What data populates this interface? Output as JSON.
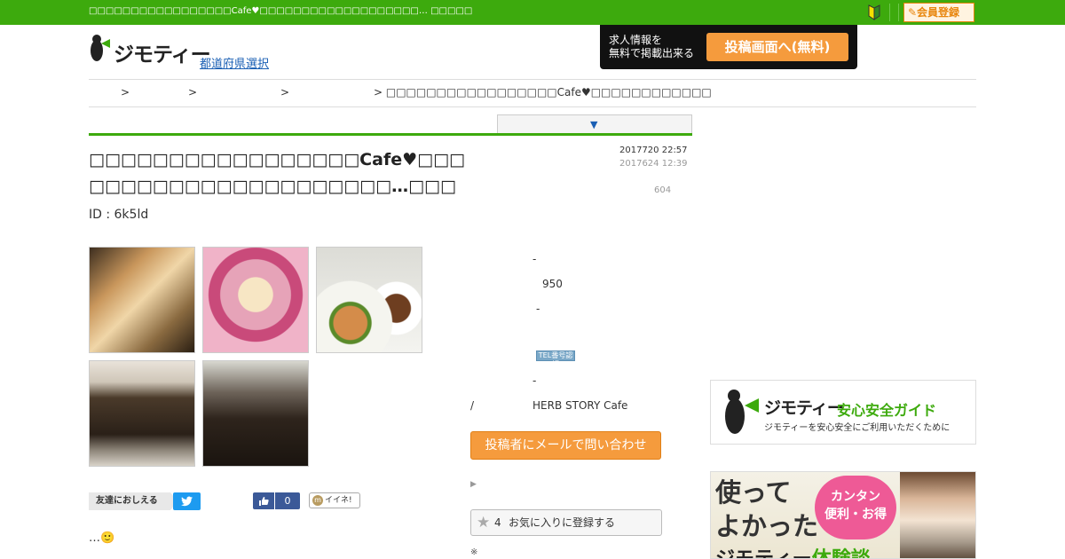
{
  "topbar": {
    "message": "□□□□□□□□□□□□□□□□□Cafe♥□□□□□□□□□□□□□□□□□□□… □□□□□",
    "register_label": "✎会員登録",
    "icons": [
      "beginner-mark-icon",
      "pencil-icon"
    ]
  },
  "header": {
    "logo_text": "ジモティー",
    "prefecture_link": "都道府県選択",
    "banner_text_line1": "求人情報を",
    "banner_text_line2": "無料で掲載出来る",
    "banner_button": "投稿画面へ(無料)"
  },
  "breadcrumb": {
    "sep1": ">",
    "sep2": ">",
    "sep3": ">",
    "current": ">  □□□□□□□□□□□□□□□□□Cafe♥□□□□□□□□□□□□"
  },
  "post": {
    "toggle_arrow": "▼",
    "title_line1": "□□□□□□□□□□□□□□□□□Cafe♥□□□",
    "title_line2": "□□□□□□□□□□□□□□□□□□□…□□□",
    "posted_date": "2017720 22:57",
    "updated_date": "2017624 12:39",
    "views": "604",
    "id_text": "ID : 6k5ld"
  },
  "details": {
    "row1": "-",
    "row2": "950",
    "row3": "-",
    "tel_badge": "TEL番号認証",
    "row5": "-",
    "row6_label": "/",
    "row6_value": "HERB STORY Cafe",
    "mail_button": "投稿者にメールで問い合わせ",
    "more_triangle": "▶",
    "fav_count": "4",
    "fav_label": "お気に入りに登録する",
    "note_mark": "※"
  },
  "share": {
    "label": "友達におしえる",
    "twitter_glyph": "🐦",
    "fb_glyph": "👍",
    "fb_count": "0",
    "iine_label": "イイネ!",
    "iine_glyph": "m"
  },
  "body": {
    "text": "…🙂"
  },
  "sidebar": {
    "guide_logo": "ジモティー",
    "guide_title": "安心安全ガイド",
    "guide_desc": "ジモティーを安心安全にご利用いただくために",
    "exp_big": "使って よかった",
    "exp_bubble_line1": "カンタン",
    "exp_bubble_line2": "便利・お得",
    "exp_bottom1": "ジモティー",
    "exp_bottom2": "体験談"
  },
  "colors": {
    "brand_green": "#3daa0d",
    "accent_orange": "#f59b3d",
    "link_blue": "#1a5fb4"
  }
}
